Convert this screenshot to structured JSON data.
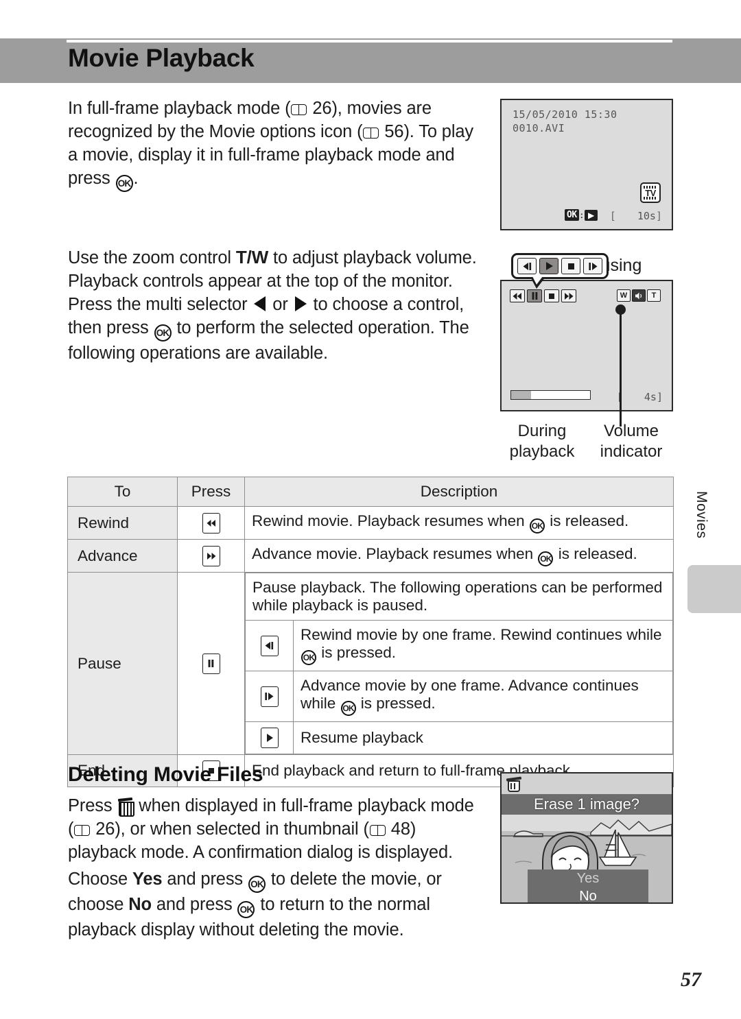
{
  "page": {
    "title": "Movie Playback",
    "number": "57",
    "side_tab_label": "Movies",
    "header_bg": "#9d9d9d"
  },
  "paragraphs": {
    "intro_1": "In full-frame playback mode (",
    "intro_2": " 26), movies are recognized by the Movie options icon (",
    "intro_3": " 56). To play a movie, display it in full-frame playback mode and press ",
    "intro_4": ".",
    "controls_1": "Use the zoom control ",
    "controls_tw": "T/W",
    "controls_2": " to adjust playback volume. Playback controls appear at the top of the monitor. Press the multi selector ",
    "controls_3": " or ",
    "controls_4": " to choose a control, then press ",
    "controls_5": " to perform the selected operation. The following operations are available.",
    "delete_1": "Press ",
    "delete_2": " when displayed in full-frame playback mode (",
    "delete_3": " 26), or when selected in thumbnail (",
    "delete_4": " 48) playback mode. A confirmation dialog is displayed.",
    "delete_5": "Choose ",
    "delete_yes": "Yes",
    "delete_6": " and press ",
    "delete_7": " to delete the movie, or choose ",
    "delete_no": "No",
    "delete_8": " and press ",
    "delete_9": " to return to the normal playback display without deleting the movie."
  },
  "section_heading": "Deleting Movie Files",
  "screen_top": {
    "datetime": "15/05/2010 15:30",
    "filename": "0010.AVI",
    "tv_badge": "TV",
    "ok_label": "OK",
    "ok_separator": ":",
    "duration": "10s",
    "bracket_open": "[",
    "bracket_close": "]"
  },
  "screen_playback": {
    "callout_label": "Pausing",
    "callout_buttons": [
      {
        "name": "frame-rewind",
        "selected": false
      },
      {
        "name": "play",
        "selected": true
      },
      {
        "name": "stop",
        "selected": false
      },
      {
        "name": "frame-advance",
        "selected": false
      }
    ],
    "screen_buttons": [
      {
        "name": "rewind",
        "selected": false
      },
      {
        "name": "pause",
        "selected": true
      },
      {
        "name": "stop",
        "selected": false
      },
      {
        "name": "advance",
        "selected": false
      }
    ],
    "volume": {
      "wide": "W",
      "speaker": "speaker",
      "tele": "T"
    },
    "progress_percent": 25,
    "duration": "4s",
    "caption_left": "During playback",
    "caption_right": "Volume indicator"
  },
  "screen_erase": {
    "title": "Erase 1 image?",
    "options": [
      {
        "label": "Yes",
        "selected": false
      },
      {
        "label": "No",
        "selected": true
      }
    ]
  },
  "table": {
    "headers": [
      "To",
      "Press",
      "Description"
    ],
    "rows": [
      {
        "to": "Rewind",
        "icon": "rewind",
        "desc_before": "Rewind movie. Playback resumes when ",
        "desc_after": " is released."
      },
      {
        "to": "Advance",
        "icon": "advance",
        "desc_before": "Advance movie. Playback resumes when ",
        "desc_after": " is released."
      },
      {
        "to": "Pause",
        "icon": "pause",
        "desc_main": "Pause playback. The following operations can be performed while playback is paused.",
        "sub_rows": [
          {
            "icon": "frame-rewind",
            "text_before": "Rewind movie by one frame. Rewind continues while ",
            "text_after": " is pressed."
          },
          {
            "icon": "frame-advance",
            "text_before": "Advance movie by one frame. Advance continues while ",
            "text_after": " is pressed."
          },
          {
            "icon": "play",
            "text_before": "Resume playback",
            "text_after": ""
          }
        ]
      },
      {
        "to": "End",
        "icon": "stop",
        "desc_before": "End playback and return to full-frame playback.",
        "desc_after": ""
      }
    ]
  }
}
